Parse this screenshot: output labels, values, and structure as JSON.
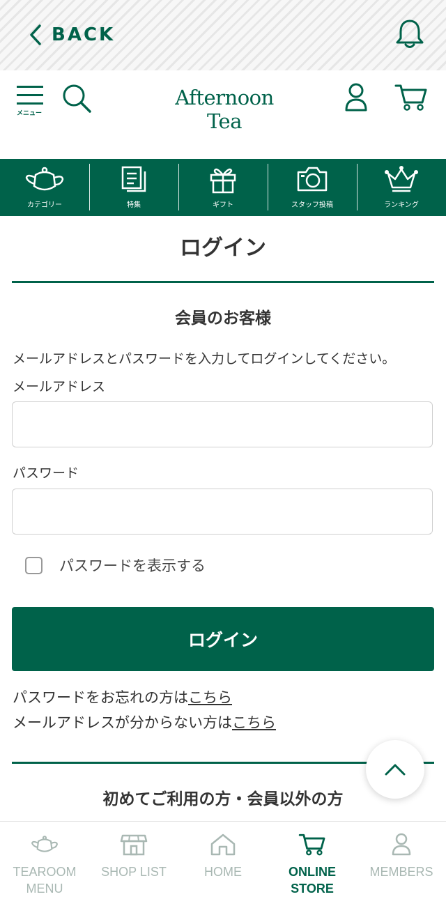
{
  "topbar": {
    "back_label": "BACK"
  },
  "header": {
    "menu_caption": "メニュー",
    "logo_text": "Afternoon Tea"
  },
  "category_nav": [
    {
      "label": "カテゴリー",
      "icon": "teapot-icon"
    },
    {
      "label": "特集",
      "icon": "feature-docs-icon"
    },
    {
      "label": "ギフト",
      "icon": "gift-icon"
    },
    {
      "label": "スタッフ投稿",
      "icon": "camera-icon"
    },
    {
      "label": "ランキング",
      "icon": "crown-icon"
    }
  ],
  "main": {
    "title": "ログイン",
    "member_section_title": "会員のお客様",
    "instruction": "メールアドレスとパスワードを入力してログインしてください。",
    "email_label": "メールアドレス",
    "email_value": "",
    "password_label": "パスワード",
    "password_value": "",
    "show_password_label": "パスワードを表示する",
    "login_button": "ログイン",
    "forgot_password_text": "パスワードをお忘れの方は",
    "forgot_password_link": "こちら",
    "forgot_email_text": "メールアドレスが分からない方は",
    "forgot_email_link": "こちら",
    "new_customer_title": "初めてご利用の方・会員以外の方"
  },
  "bottom_nav": [
    {
      "label_line1": "TEAROOM",
      "label_line2": "MENU",
      "active": false
    },
    {
      "label_line1": "SHOP LIST",
      "label_line2": "",
      "active": false
    },
    {
      "label_line1": "HOME",
      "label_line2": "",
      "active": false
    },
    {
      "label_line1": "ONLINE STORE",
      "label_line2": "",
      "active": true
    },
    {
      "label_line1": "MEMBERS",
      "label_line2": "",
      "active": false
    }
  ],
  "colors": {
    "brand_green": "#00624a",
    "inactive_nav": "#a9b8b3"
  }
}
